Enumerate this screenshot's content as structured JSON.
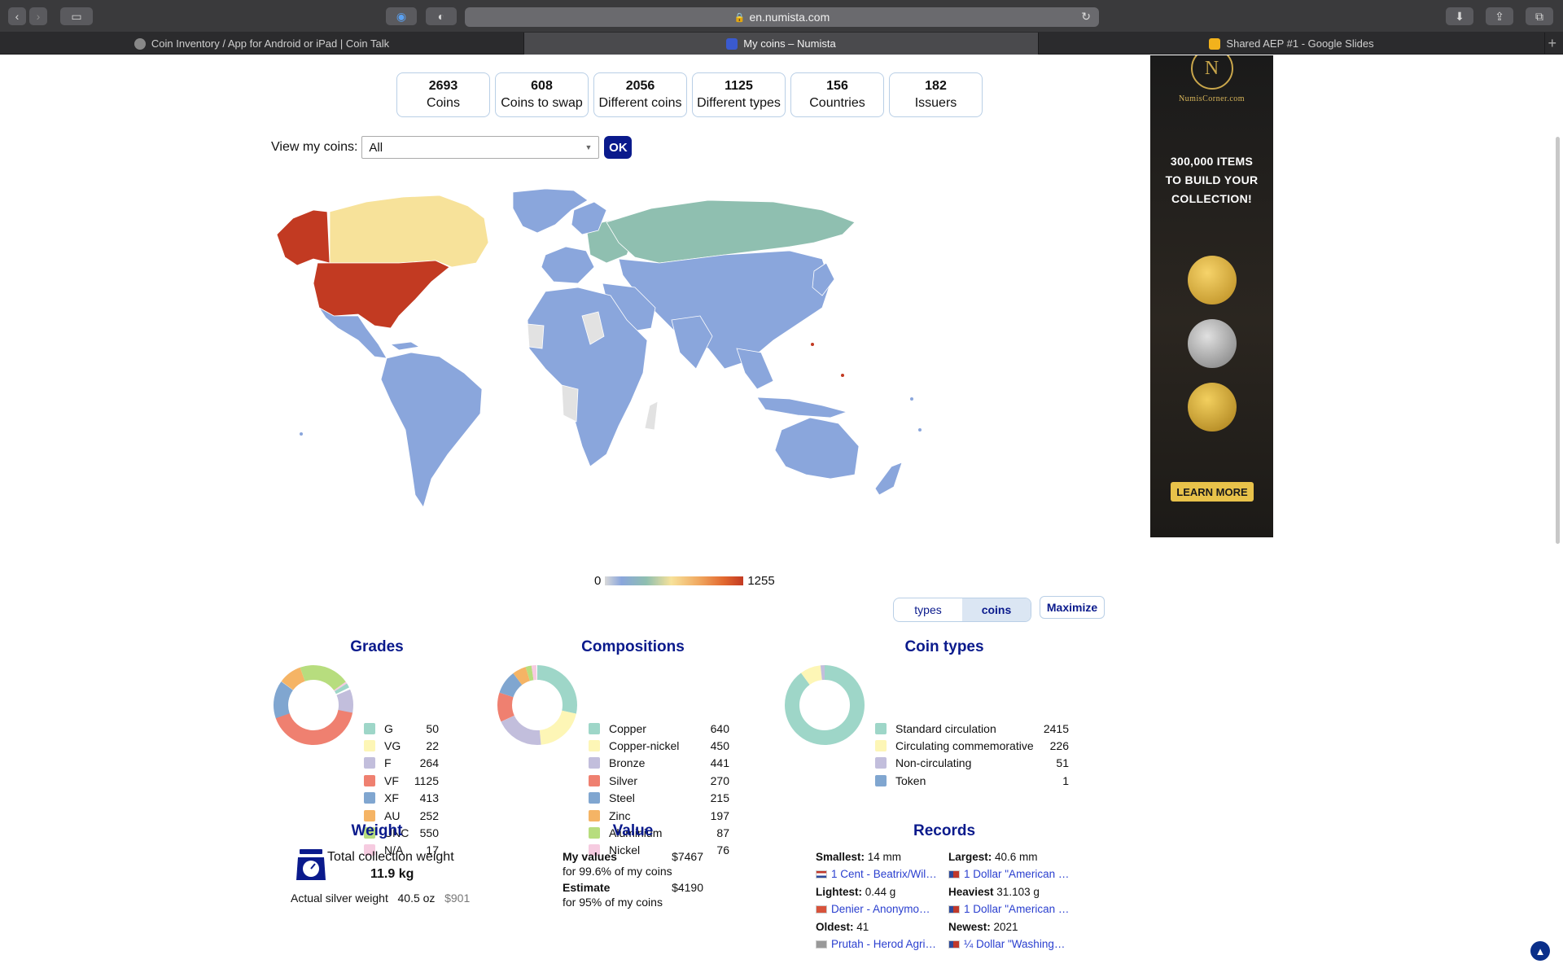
{
  "browser": {
    "url": "en.numista.com",
    "tabs": [
      {
        "label": "Coin Inventory / App for Android or iPad | Coin Talk"
      },
      {
        "label": "My coins – Numista"
      },
      {
        "label": "Shared AEP #1 - Google Slides"
      }
    ]
  },
  "stats": [
    {
      "value": "2693",
      "label": "Coins"
    },
    {
      "value": "608",
      "label": "Coins to swap"
    },
    {
      "value": "2056",
      "label": "Different coins"
    },
    {
      "value": "1125",
      "label": "Different types"
    },
    {
      "value": "156",
      "label": "Countries"
    },
    {
      "value": "182",
      "label": "Issuers"
    }
  ],
  "view": {
    "label": "View my coins:",
    "selected": "All",
    "ok": "OK"
  },
  "map_legend": {
    "min": "0",
    "max": "1255"
  },
  "toggle": {
    "types": "types",
    "coins": "coins",
    "maximize": "Maximize"
  },
  "grades": {
    "title": "Grades",
    "items": [
      {
        "name": "G",
        "value": "50",
        "color": "#9ed6c8"
      },
      {
        "name": "VG",
        "value": "22",
        "color": "#fdf6b6"
      },
      {
        "name": "F",
        "value": "264",
        "color": "#c2bedc"
      },
      {
        "name": "VF",
        "value": "1125",
        "color": "#ef8070"
      },
      {
        "name": "XF",
        "value": "413",
        "color": "#80a6d0"
      },
      {
        "name": "AU",
        "value": "252",
        "color": "#f5b465"
      },
      {
        "name": "UNC",
        "value": "550",
        "color": "#b7dd7e"
      },
      {
        "name": "N/A",
        "value": "17",
        "color": "#f6cbe0"
      }
    ]
  },
  "compositions": {
    "title": "Compositions",
    "items": [
      {
        "name": "Copper",
        "value": "640",
        "color": "#9ed6c8"
      },
      {
        "name": "Copper-nickel",
        "value": "450",
        "color": "#fdf6b6"
      },
      {
        "name": "Bronze",
        "value": "441",
        "color": "#c2bedc"
      },
      {
        "name": "Silver",
        "value": "270",
        "color": "#ef8070"
      },
      {
        "name": "Steel",
        "value": "215",
        "color": "#80a6d0"
      },
      {
        "name": "Zinc",
        "value": "197",
        "color": "#f5b465"
      },
      {
        "name": "Aluminium",
        "value": "87",
        "color": "#b7dd7e"
      },
      {
        "name": "Nickel",
        "value": "76",
        "color": "#f6cbe0"
      }
    ]
  },
  "coin_types": {
    "title": "Coin types",
    "items": [
      {
        "name": "Standard circulation",
        "value": "2415",
        "color": "#9ed6c8"
      },
      {
        "name": "Circulating commemorative",
        "value": "226",
        "color": "#fdf6b6"
      },
      {
        "name": "Non-circulating",
        "value": "51",
        "color": "#c2bedc"
      },
      {
        "name": "Token",
        "value": "1",
        "color": "#80a6d0"
      }
    ]
  },
  "weight": {
    "title": "Weight",
    "total_label": "Total collection weight",
    "total": "11.9 kg",
    "silver_label": "Actual silver weight",
    "silver_weight": "40.5 oz",
    "silver_value": "$901"
  },
  "value": {
    "title": "Value",
    "my_values_label": "My values",
    "my_values": "$7467",
    "my_values_note": "for 99.6% of my coins",
    "estimate_label": "Estimate",
    "estimate": "$4190",
    "estimate_note": "for 95% of my coins"
  },
  "records": {
    "title": "Records",
    "smallest_label": "Smallest:",
    "smallest": " 14 mm",
    "smallest_coin": "1 Cent - Beatrix/Wil…",
    "largest_label": "Largest:",
    "largest": " 40.6 mm",
    "largest_coin": "1 Dollar \"American …",
    "lightest_label": "Lightest:",
    "lightest": " 0.44 g",
    "lightest_coin": "Denier - Anonymo…",
    "heaviest_label": "Heaviest",
    "heaviest": " 31.103 g",
    "heaviest_coin": "1 Dollar \"American …",
    "oldest_label": "Oldest:",
    "oldest": " 41",
    "oldest_coin": "Prutah - Herod Agri…",
    "newest_label": "Newest:",
    "newest": " 2021",
    "newest_coin": "¼ Dollar \"Washing…"
  },
  "ad": {
    "logo": "NumisCorner.com",
    "headline_1": "300,000 ITEMS",
    "headline_2": "TO BUILD YOUR",
    "headline_3": "COLLECTION!",
    "cta": "LEARN MORE"
  },
  "colors": {
    "accent": "#0a1a8c",
    "usa": "#c23a22",
    "canada": "#f7e29a",
    "europe_asia": "#8fbfb0",
    "world": "#8aa6dc"
  }
}
